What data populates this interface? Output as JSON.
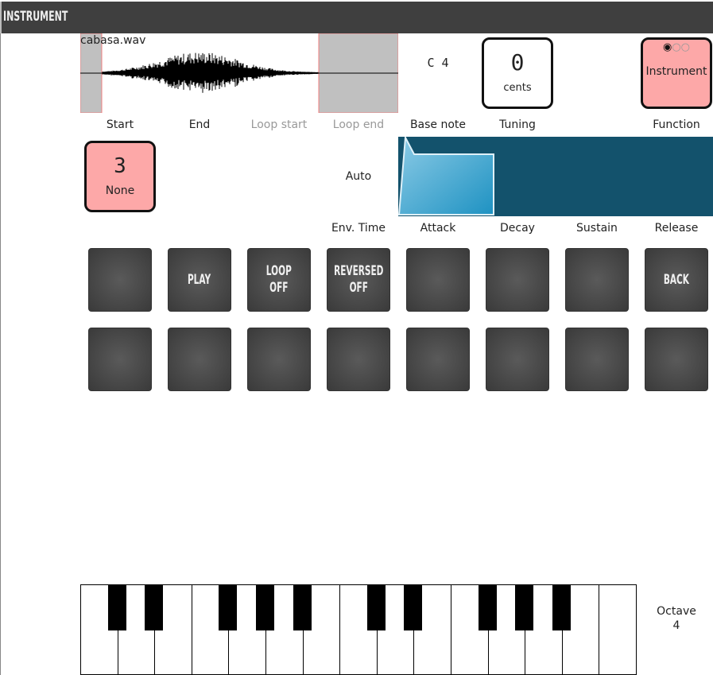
{
  "window": {
    "title": "INSTRUMENT"
  },
  "sample": {
    "filename": "cabasa.wav"
  },
  "labels": {
    "start": "Start",
    "end": "End",
    "loop_start": "Loop start",
    "loop_end": "Loop end",
    "base_note": "Base note",
    "tuning": "Tuning",
    "function": "Function",
    "env_time": "Env. Time",
    "attack": "Attack",
    "decay": "Decay",
    "sustain": "Sustain",
    "release": "Release"
  },
  "base_note": {
    "value": "C 4"
  },
  "tuning": {
    "value": "0",
    "unit": "cents"
  },
  "function": {
    "value": "Instrument",
    "pages": 3,
    "active_page": 1,
    "color": "#fda8a8"
  },
  "selector": {
    "value": "3",
    "label": "None",
    "color": "#fda8a8"
  },
  "env_time": {
    "value": "Auto"
  },
  "envelope": {
    "color_bg": "#13526c",
    "color_fill": "#2a9bc8"
  },
  "pads": {
    "row1": [
      "",
      "PLAY",
      "LOOP\nOFF",
      "REVERSED\nOFF",
      "",
      "",
      "",
      "BACK"
    ],
    "row2": [
      "",
      "",
      "",
      "",
      "",
      "",
      "",
      ""
    ]
  },
  "keyboard": {
    "octave_label": "Octave",
    "octave_value": "4"
  }
}
